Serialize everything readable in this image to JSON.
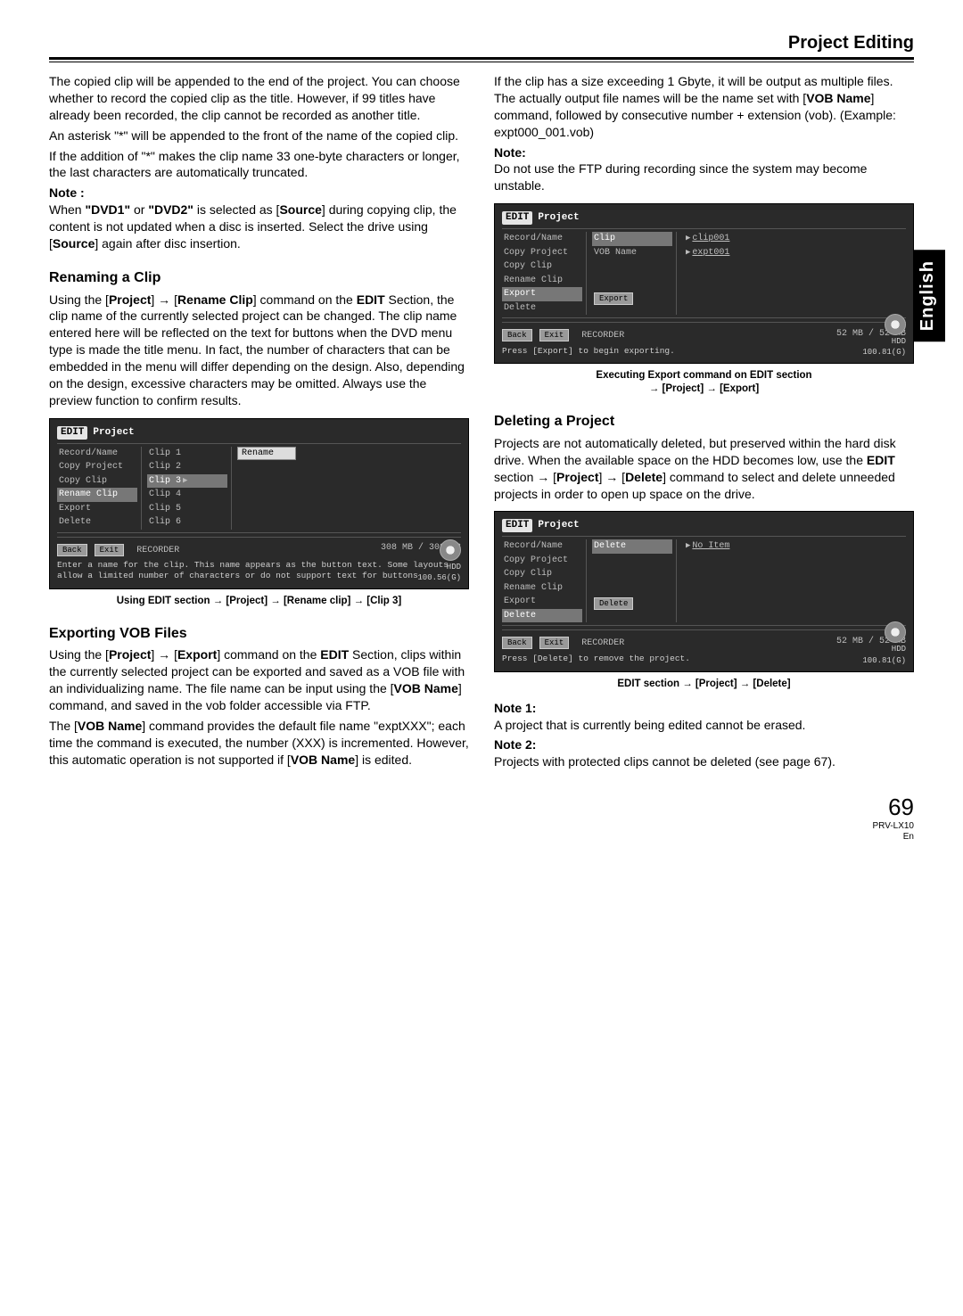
{
  "header": {
    "title": "Project Editing"
  },
  "side_tab": "English",
  "left": {
    "p1": "The copied clip will be appended to the end of the project. You can choose whether to record the copied clip as the title. However, if 99 titles have already been recorded, the clip cannot be recorded as another title.",
    "p2": "An asterisk \"*\" will be appended to the front of the name of the copied clip.",
    "p3": "If the addition of \"*\" makes the clip name 33 one-byte characters or longer, the last characters are automatically truncated.",
    "note_label": "Note :",
    "note_a": "When ",
    "note_b1": "\"DVD1\"",
    "note_c": " or ",
    "note_b2": "\"DVD2\"",
    "note_d": " is selected as [",
    "note_src": "Source",
    "note_e": "] during copying clip, the content is not updated when a disc is inserted. Select the drive using [",
    "note_f": "] again after disc insertion.",
    "h_rename": "Renaming a Clip",
    "rename_a": "Using the [",
    "rename_b": "Project",
    "rename_c": "] → [",
    "rename_d": "Rename Clip",
    "rename_e": "] command on the ",
    "rename_f": "EDIT",
    "rename_g": " Section, the clip name of the currently selected project can be changed. The clip name entered here will be reflected on the text for buttons when the DVD menu type is made the title menu. In fact, the number of characters that can be embedded in the menu will differ depending on the design. Also, depending on the design, excessive characters may be omitted.  Always use the preview function to confirm results.",
    "cap1": "Using EDIT section → [Project] → [Rename clip] → [Clip 3]",
    "h_export": "Exporting VOB Files",
    "exp_a": "Using the [",
    "exp_b": "Project",
    "exp_c": "] → [",
    "exp_d": "Export",
    "exp_e": "] command on the ",
    "exp_f": "EDIT",
    "exp_g": " Section, clips within the currently selected project can be exported and saved as a VOB file with an individualizing name. The file name can be input using the [",
    "exp_h": "VOB Name",
    "exp_i": "] command, and saved in the vob folder accessible via FTP.",
    "exp2_a": "The [",
    "exp2_b": "VOB Name",
    "exp2_c": "] command provides the default file name \"exptXXX\"; each time the command is executed, the number (XXX) is incremented. However, this automatic operation is not supported if [",
    "exp2_d": "VOB Name",
    "exp2_e": "] is edited."
  },
  "right": {
    "p1_a": "If the clip has a size exceeding 1 Gbyte, it will be output as multiple files. The actually output file names will be the name set with [",
    "p1_b": "VOB Name",
    "p1_c": "] command, followed by consecutive number + extension (vob). (Example: expt000_001.vob)",
    "note_label": "Note:",
    "note_text": "Do not use the FTP during recording since the system may become unstable.",
    "cap2a": "Executing Export command on EDIT section",
    "cap2b": "→ [Project] → [Export]",
    "h_delete": "Deleting a Project",
    "del_a": "Projects are not automatically deleted, but preserved within the hard disk drive. When the available space on the HDD becomes low, use the ",
    "del_b": "EDIT",
    "del_c": " section → [",
    "del_d": "Project",
    "del_e": "] → [",
    "del_f": "Delete",
    "del_g": "] command to select and delete unneeded projects in order to open up space on the drive.",
    "cap3": "EDIT section → [Project] → [Delete]",
    "n1_label": "Note 1:",
    "n1": "A project that is currently being edited cannot be erased.",
    "n2_label": "Note 2:",
    "n2": "Projects with protected clips cannot be deleted (see page 67)."
  },
  "shot1": {
    "title_edit": "EDIT",
    "title": "Project",
    "left_menu": [
      "Record/Name",
      "Copy Project",
      "Copy Clip",
      "Rename Clip",
      "Export",
      "Delete"
    ],
    "mid_menu": [
      "Clip 1",
      "Clip 2",
      "Clip 3",
      "Clip 4",
      "Clip 5",
      "Clip 6"
    ],
    "right_top": "Rename",
    "back": "Back",
    "exit": "Exit",
    "recorder": "RECORDER",
    "cap": "308 MB /  308 MB",
    "msg": "Enter a name for the clip. This name appears as the button text. Some layouts allow a limited number of characters or do not support text for buttons.",
    "hdd": "HDD",
    "hddv": "100.56(G)"
  },
  "shot2": {
    "title_edit": "EDIT",
    "title": "Project",
    "left_menu": [
      "Record/Name",
      "Copy Project",
      "Copy Clip",
      "Rename Clip",
      "Export",
      "Delete"
    ],
    "mid": [
      "Clip",
      "VOB Name"
    ],
    "right": [
      "clip001",
      "expt001"
    ],
    "export_btn": "Export",
    "back": "Back",
    "exit": "Exit",
    "recorder": "RECORDER",
    "cap": "52 MB /   52 MB",
    "msg": "Press [Export] to begin exporting.",
    "hdd": "HDD",
    "hddv": "100.81(G)"
  },
  "shot3": {
    "title_edit": "EDIT",
    "title": "Project",
    "left_menu": [
      "Record/Name",
      "Copy Project",
      "Copy Clip",
      "Rename Clip",
      "Export",
      "Delete"
    ],
    "mid": [
      "Delete"
    ],
    "right": [
      "No Item"
    ],
    "delete_btn": "Delete",
    "back": "Back",
    "exit": "Exit",
    "recorder": "RECORDER",
    "cap": "52 MB /   52 MB",
    "msg": "Press [Delete] to remove the project.",
    "hdd": "HDD",
    "hddv": "100.81(G)"
  },
  "footer": {
    "page": "69",
    "model": "PRV-LX10",
    "lang": "En"
  }
}
